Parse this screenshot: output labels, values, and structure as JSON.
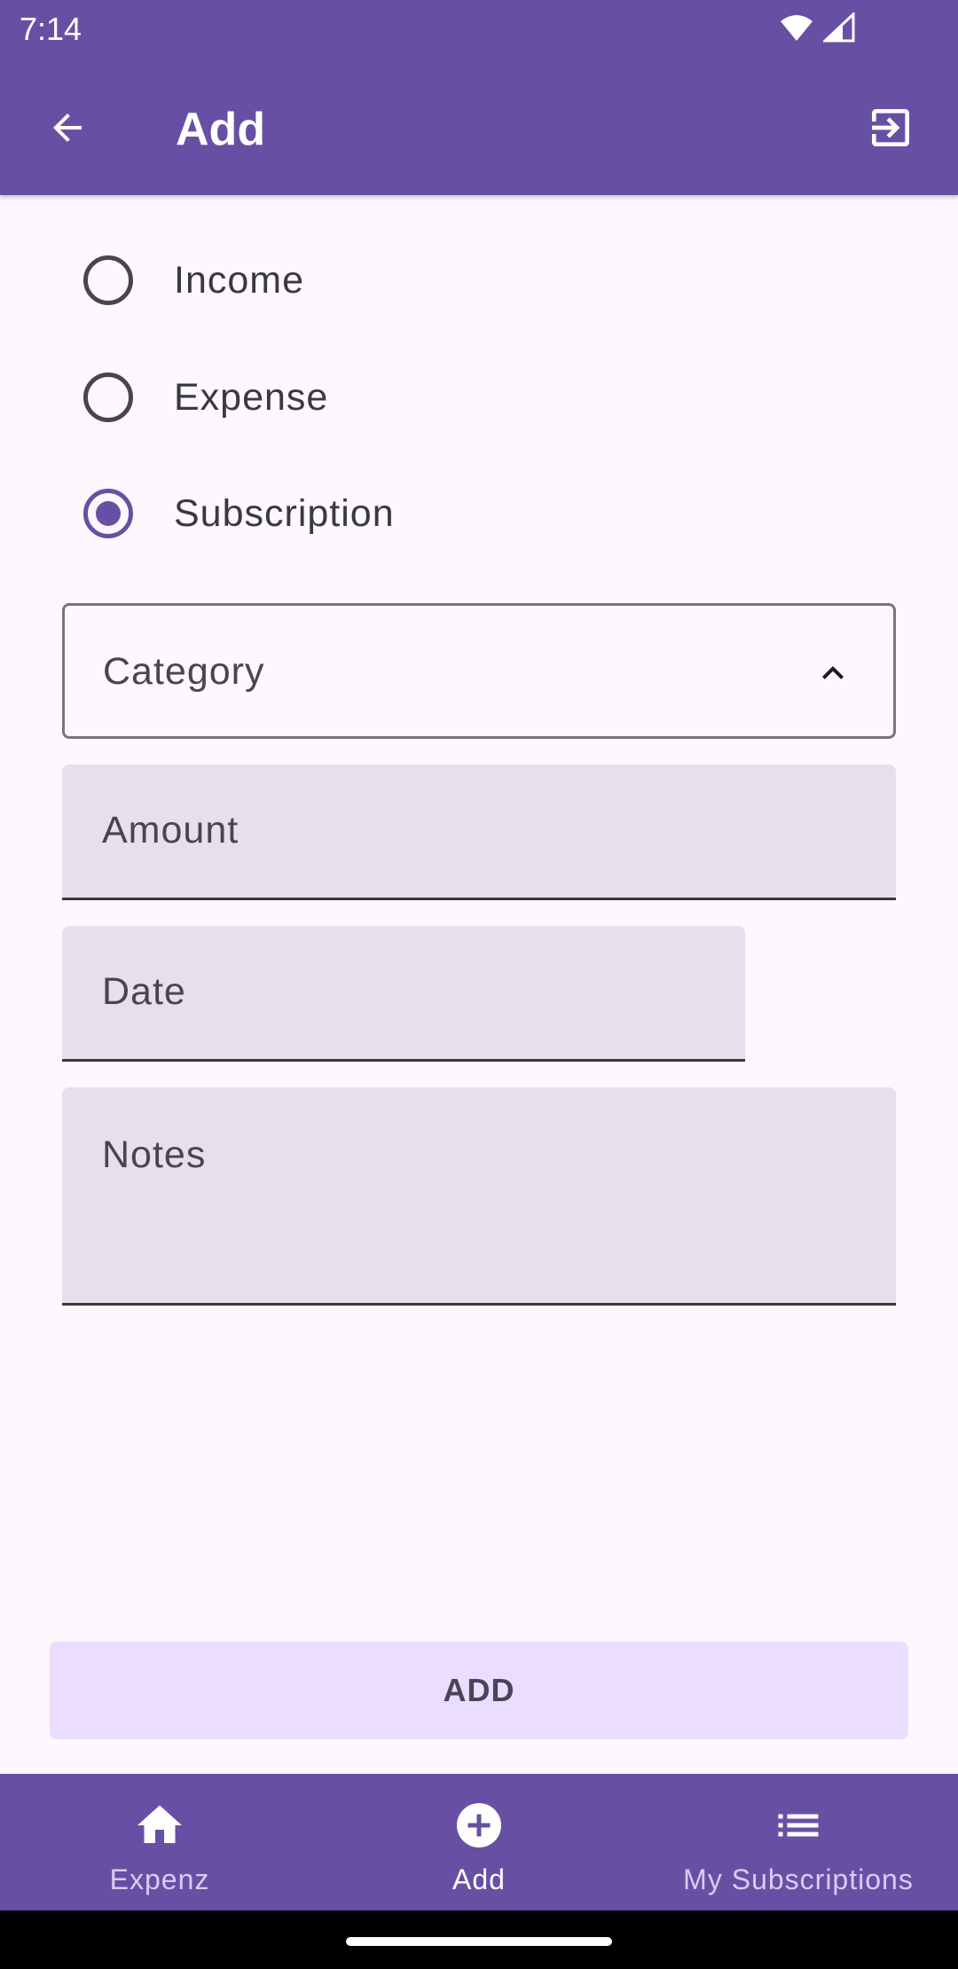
{
  "status_bar": {
    "time": "7:14"
  },
  "app_bar": {
    "title": "Add"
  },
  "type_options": [
    {
      "label": "Income",
      "checked": false
    },
    {
      "label": "Expense",
      "checked": false
    },
    {
      "label": "Subscription",
      "checked": true
    }
  ],
  "form": {
    "category_label": "Category",
    "amount_label": "Amount",
    "date_label": "Date",
    "notes_label": "Notes"
  },
  "add_button_label": "ADD",
  "bottom_nav": [
    {
      "label": "Expenz",
      "icon": "home-icon",
      "active": false
    },
    {
      "label": "Add",
      "icon": "add-circle-icon",
      "active": true
    },
    {
      "label": "My Subscriptions",
      "icon": "list-icon",
      "active": false
    }
  ],
  "colors": {
    "primary": "#6750A4",
    "surface": "#FDF7FE",
    "field_fill": "#E6E0EC",
    "button_fill": "#EADDFF"
  }
}
